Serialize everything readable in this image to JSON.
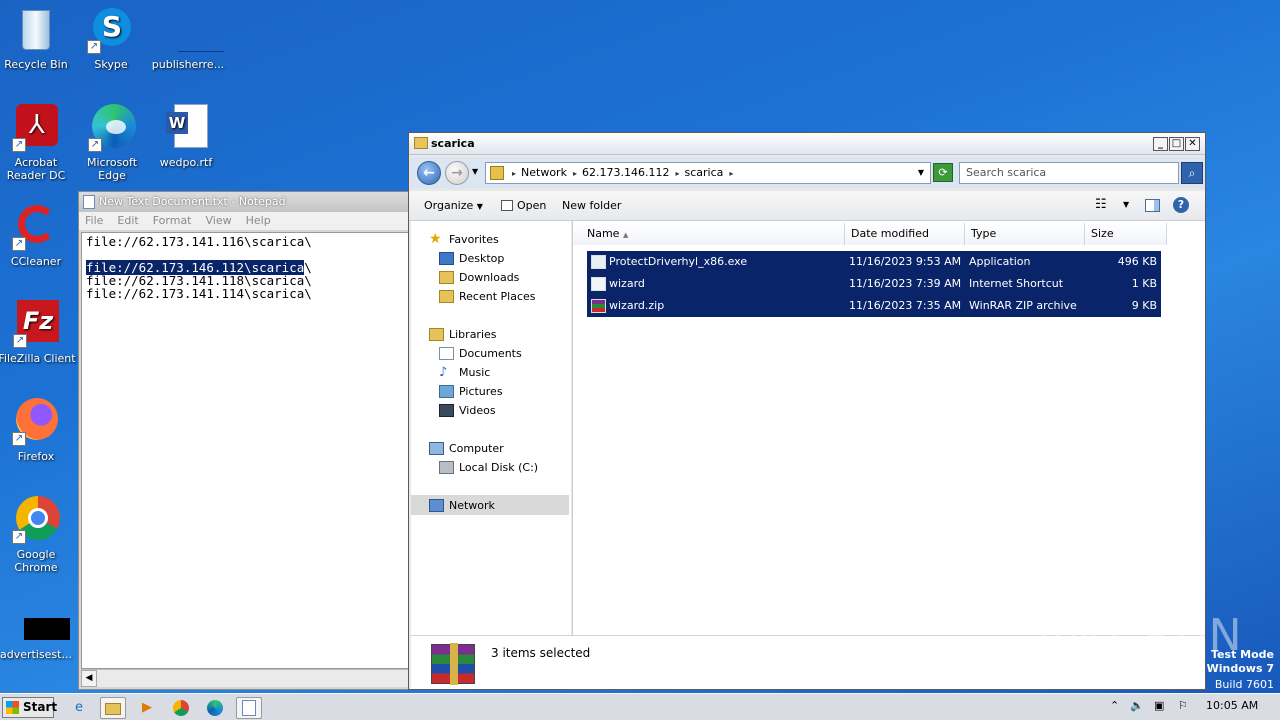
{
  "desktop": {
    "icons": [
      {
        "label": "Recycle Bin"
      },
      {
        "label": "Skype"
      },
      {
        "label": "publisherre..."
      },
      {
        "label": "Acrobat Reader DC"
      },
      {
        "label": "Microsoft Edge"
      },
      {
        "label": "wedpo.rtf"
      },
      {
        "label": "CCleaner"
      },
      {
        "label": "FileZilla Client"
      },
      {
        "label": "Firefox"
      },
      {
        "label": "Google Chrome"
      },
      {
        "label": "advertisest..."
      }
    ]
  },
  "notepad": {
    "title": "New Text Document.txt - Notepad",
    "menu": [
      "File",
      "Edit",
      "Format",
      "View",
      "Help"
    ],
    "lines": [
      "file://62.173.141.116\\scarica\\",
      "",
      "file://62.173.146.112\\scarica",
      "file://62.173.141.118\\scarica\\",
      "file://62.173.141.114\\scarica\\"
    ],
    "line3_tail": "\\"
  },
  "explorer": {
    "title": "scarica",
    "breadcrumb": [
      "Network",
      "62.173.146.112",
      "scarica"
    ],
    "search_placeholder": "Search scarica",
    "toolbar": {
      "organize": "Organize",
      "open": "Open",
      "new_folder": "New folder"
    },
    "nav": {
      "favorites": "Favorites",
      "desktop": "Desktop",
      "downloads": "Downloads",
      "recent": "Recent Places",
      "libraries": "Libraries",
      "documents": "Documents",
      "music": "Music",
      "pictures": "Pictures",
      "videos": "Videos",
      "computer": "Computer",
      "local_disk": "Local Disk (C:)",
      "network": "Network"
    },
    "columns": [
      "Name",
      "Date modified",
      "Type",
      "Size"
    ],
    "files": [
      {
        "name": "ProtectDriverhyl_x86.exe",
        "date": "11/16/2023 9:53 AM",
        "type": "Application",
        "size": "496 KB"
      },
      {
        "name": "wizard",
        "date": "11/16/2023 7:39 AM",
        "type": "Internet Shortcut",
        "size": "1 KB"
      },
      {
        "name": "wizard.zip",
        "date": "11/16/2023 7:35 AM",
        "type": "WinRAR ZIP archive",
        "size": "9 KB"
      }
    ],
    "status": "3 items selected"
  },
  "taskbar": {
    "start": "Start",
    "clock": "10:05 AM"
  },
  "watermark": {
    "text": "ANY RUN",
    "test_mode": "Test Mode",
    "os": "Windows 7",
    "build": "Build 7601"
  }
}
